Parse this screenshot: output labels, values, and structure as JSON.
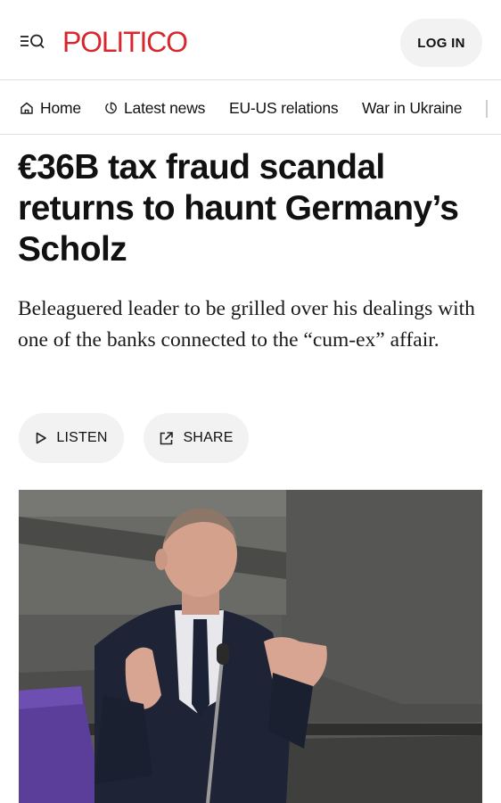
{
  "header": {
    "logo": "POLITICO",
    "login_label": "LOG IN",
    "menu_icon": "menu-search-icon"
  },
  "nav": {
    "items": [
      {
        "label": "Home",
        "icon": "home-icon"
      },
      {
        "label": "Latest news",
        "icon": "clock-icon"
      },
      {
        "label": "EU-US relations"
      },
      {
        "label": "War in Ukraine"
      }
    ]
  },
  "article": {
    "headline": "€36B tax fraud scandal returns to haunt Germany’s Scholz",
    "dek": "Beleaguered leader to be grilled over his dealings with one of the banks connected to the “cum-ex” affair.",
    "listen_label": "LISTEN",
    "share_label": "SHARE",
    "photo_icon": "article-photo"
  },
  "colors": {
    "brand": "#d6272d",
    "button_bg": "#f2f2f2",
    "text": "#111111"
  }
}
